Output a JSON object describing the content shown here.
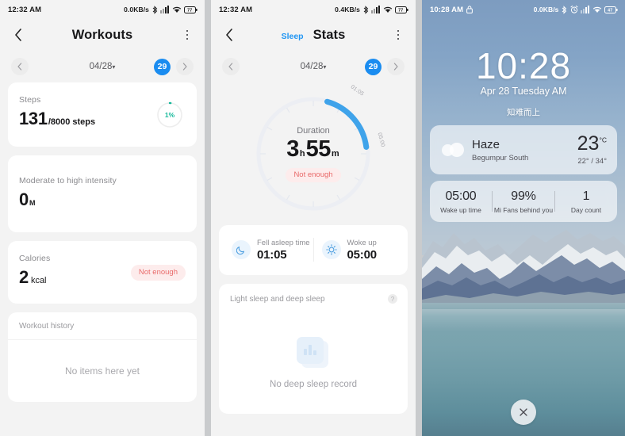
{
  "panel_workouts": {
    "statusbar": {
      "time": "12:32 AM",
      "net_speed": "0.0KB/s",
      "battery": "77"
    },
    "header": {
      "title": "Workouts",
      "back_icon": "chevron-left-icon",
      "menu_icon": "kebab-menu-icon"
    },
    "datenav": {
      "prev_icon": "chevron-left-icon",
      "date": "04/28",
      "caret": "▾",
      "day": "29",
      "next_icon": "chevron-right-icon"
    },
    "cards": {
      "steps": {
        "label": "Steps",
        "value": "131",
        "goal": "/8000 steps",
        "ring_percent": "1%",
        "ring_color": "#14b89a"
      },
      "intensity": {
        "label": "Moderate to high intensity",
        "value": "0",
        "unit": "M"
      },
      "calories": {
        "label": "Calories",
        "value": "2",
        "unit": "kcal",
        "badge": "Not enough",
        "badge_color": "#e96a6a"
      },
      "history": {
        "label": "Workout history",
        "empty": "No items here yet"
      }
    }
  },
  "panel_stats": {
    "statusbar": {
      "time": "12:32 AM",
      "net_speed": "0.4KB/s",
      "battery": "77"
    },
    "header": {
      "title": "Stats",
      "subtab": "Sleep",
      "back_icon": "chevron-left-icon",
      "menu_icon": "kebab-menu-icon"
    },
    "datenav": {
      "prev_icon": "chevron-left-icon",
      "date": "04/28",
      "caret": "▾",
      "day": "29",
      "next_icon": "chevron-right-icon"
    },
    "sleep_ring": {
      "caption": "Duration",
      "hours": "3",
      "h_unit": "h",
      "minutes": "55",
      "m_unit": "m",
      "badge": "Not enough",
      "start_label": "01:05",
      "end_label": "05:00",
      "arc_color": "#3fa3ea"
    },
    "sleep_detail": {
      "fell_asleep_label": "Fell asleep time",
      "fell_asleep_value": "01:05",
      "fell_asleep_icon": "moon-icon",
      "woke_up_label": "Woke up",
      "woke_up_value": "05:00",
      "woke_up_icon": "sun-icon"
    },
    "deep_sleep": {
      "title": "Light sleep and deep sleep",
      "help_icon": "help-circle-icon",
      "empty": "No deep sleep record",
      "placeholder_icon": "bar-chart-icon"
    }
  },
  "panel_lockscreen": {
    "statusbar": {
      "time": "10:28 AM",
      "lock_icon": "lock-icon",
      "net_speed": "0.0KB/s",
      "alarm_icon": "alarm-icon",
      "battery": "47"
    },
    "clock": {
      "time": "10:28",
      "date": "Apr 28 Tuesday AM"
    },
    "motto": "知难而上",
    "weather": {
      "icon": "haze-cloud-icon",
      "condition": "Haze",
      "location": "Begumpur South",
      "temp": "23",
      "temp_unit": "°C",
      "range": "22° / 34°"
    },
    "stats": [
      {
        "value": "05:00",
        "label": "Wake up time"
      },
      {
        "value": "99%",
        "label": "Mi Fans behind you"
      },
      {
        "value": "1",
        "label": "Day count"
      }
    ],
    "close_button": {
      "icon": "close-icon"
    }
  }
}
